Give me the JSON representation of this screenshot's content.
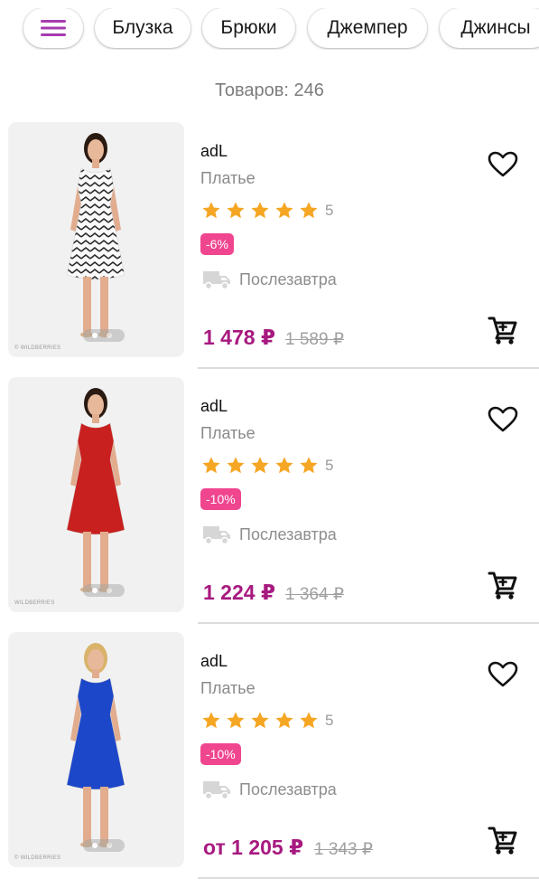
{
  "filters": {
    "menu_icon": "hamburger-menu-icon",
    "chips": [
      "Блузка",
      "Брюки",
      "Джемпер",
      "Джинсы"
    ]
  },
  "count_label": "Товаров: 246",
  "colors": {
    "accent": "#a7197f",
    "discount_badge": "#f0458f",
    "star": "#f5a623",
    "menu_icon": "#a63bb0"
  },
  "products": [
    {
      "brand": "adL",
      "name": "Платье",
      "rating_stars": 5,
      "rating": "5",
      "discount": "-6%",
      "delivery": "Послезавтра",
      "price": "1 478 ₽",
      "old_price": "1 589 ₽",
      "image_watermark": "© WILDBERRIES",
      "dress_color": "#ffffff",
      "pattern": "zigzag"
    },
    {
      "brand": "adL",
      "name": "Платье",
      "rating_stars": 5,
      "rating": "5",
      "discount": "-10%",
      "delivery": "Послезавтра",
      "price": "1 224 ₽",
      "old_price": "1 364 ₽",
      "image_watermark": "WILDBERRIES",
      "dress_color": "#c8201f",
      "pattern": "solid"
    },
    {
      "brand": "adL",
      "name": "Платье",
      "rating_stars": 5,
      "rating": "5",
      "discount": "-10%",
      "delivery": "Послезавтра",
      "price": "от 1 205 ₽",
      "old_price": "1 343 ₽",
      "image_watermark": "© WILDBERRIES",
      "dress_color": "#1d47c9",
      "pattern": "solid"
    }
  ]
}
